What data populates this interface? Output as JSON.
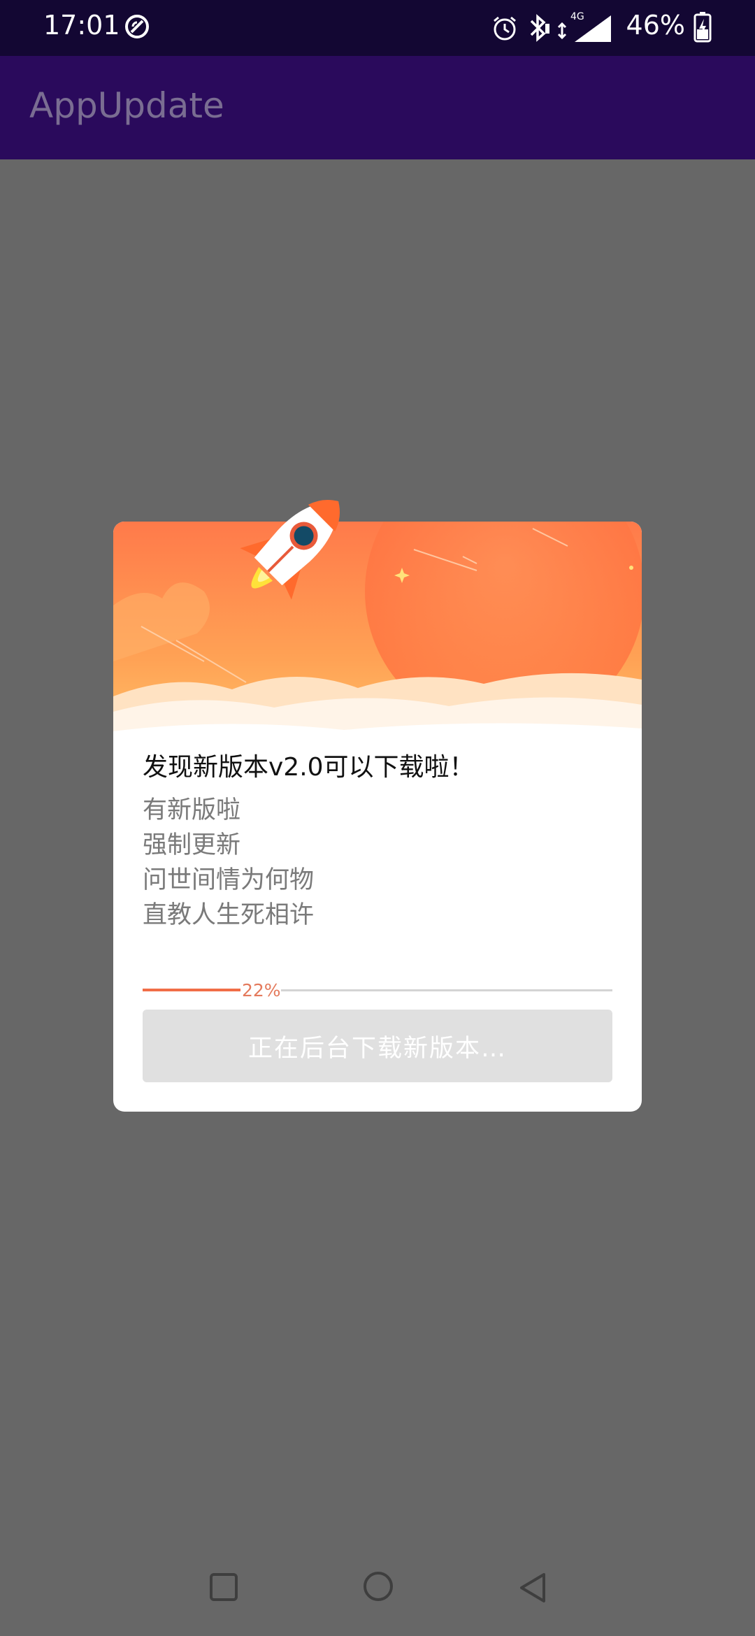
{
  "status_bar": {
    "time": "17:01",
    "battery_percent": "46%",
    "network_type": "4G",
    "icons": [
      "sync-icon",
      "alarm-icon",
      "bluetooth-icon",
      "signal-icon",
      "battery-charging-icon"
    ]
  },
  "app_bar": {
    "title": "AppUpdate"
  },
  "dialog": {
    "title": "发现新版本v2.0可以下载啦！",
    "notes": [
      "有新版啦",
      "强制更新",
      "问世间情为何物",
      "直教人生死相许"
    ],
    "progress": {
      "value": 0.22,
      "label": "22%"
    },
    "button_label": "正在后台下载新版本…",
    "header_icon": "rocket-icon"
  },
  "nav_bar": {
    "icons": [
      "recents-square-icon",
      "home-circle-icon",
      "back-triangle-icon"
    ]
  },
  "colors": {
    "status_bar": "#130733",
    "app_bar": "#2a0a5c",
    "scrim": "#676767",
    "header_gradient_top": "#ff7a4a",
    "header_gradient_bottom": "#ffc46a",
    "progress_fill": "#f16d47",
    "button_disabled": "#e0e0e0"
  }
}
